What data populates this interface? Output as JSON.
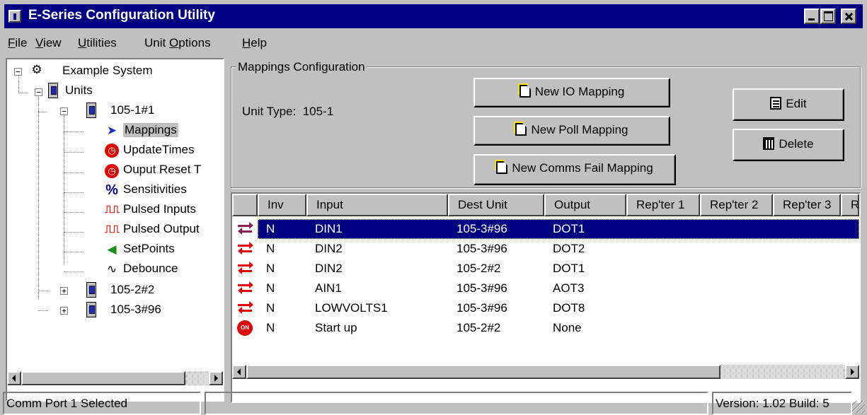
{
  "window": {
    "title": "E-Series Configuration Utility"
  },
  "menu": [
    {
      "pre": "",
      "ul": "F",
      "post": "ile"
    },
    {
      "pre": "",
      "ul": "V",
      "post": "iew"
    },
    {
      "pre": "",
      "ul": "U",
      "post": "tilities"
    },
    {
      "pre": "Unit ",
      "ul": "O",
      "post": "ptions"
    },
    {
      "pre": "",
      "ul": "H",
      "post": "elp"
    }
  ],
  "tree": {
    "root": "Example System",
    "units": "Units",
    "unit1": "105-1#1",
    "children": [
      "Mappings",
      "UpdateTimes",
      "Ouput Reset T",
      "Sensitivities",
      "Pulsed Inputs",
      "Pulsed Output",
      "SetPoints",
      "Debounce"
    ],
    "unit2": "105-2#2",
    "unit3": "105-3#96"
  },
  "mappings": {
    "group_label": "Mappings Configuration",
    "unit_type_label": "Unit Type:",
    "unit_type_value": "105-1",
    "buttons": {
      "new_io": "New IO Mapping",
      "new_poll": "New Poll Mapping",
      "new_comms_fail": "New Comms Fail Mapping",
      "edit": "Edit",
      "delete": "Delete"
    }
  },
  "list": {
    "columns": [
      "Inv",
      "Input",
      "Dest Unit",
      "Output",
      "Rep'ter 1",
      "Rep'ter 2",
      "Rep'ter 3",
      "R"
    ],
    "rows": [
      {
        "icon": "mapping-arrows-icon",
        "inv": "N",
        "input": "DIN1",
        "dest": "105-3#96",
        "output": "DOT1",
        "selected": true
      },
      {
        "icon": "mapping-arrows-icon",
        "inv": "N",
        "input": "DIN2",
        "dest": "105-3#96",
        "output": "DOT2"
      },
      {
        "icon": "mapping-arrows-icon",
        "inv": "N",
        "input": "DIN2",
        "dest": "105-2#2",
        "output": "DOT1"
      },
      {
        "icon": "mapping-arrows-icon",
        "inv": "N",
        "input": "AIN1",
        "dest": "105-3#96",
        "output": "AOT3"
      },
      {
        "icon": "mapping-arrows-icon",
        "inv": "N",
        "input": "LOWVOLTS1",
        "dest": "105-3#96",
        "output": "DOT8"
      },
      {
        "icon": "startup-on-icon",
        "icon_text": "ON",
        "inv": "N",
        "input": "Start up",
        "dest": "105-2#2",
        "output": "None"
      }
    ]
  },
  "status": {
    "left": "Comm Port 1 Selected",
    "middle": "",
    "right": "Version: 1.02 Build: 5"
  },
  "colors": {
    "title_bar": "#000080",
    "face": "#c0c0c0",
    "selection": "#000080",
    "mapping_icon": "#e00000"
  }
}
